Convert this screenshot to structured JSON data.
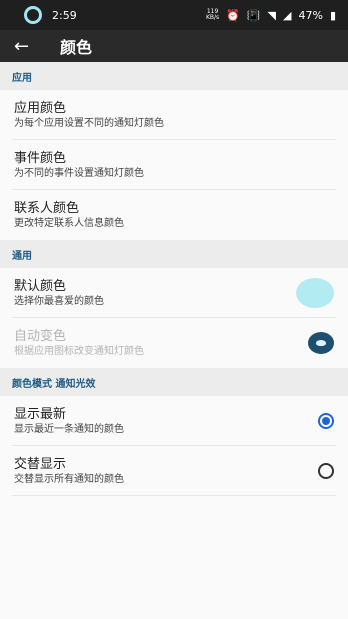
{
  "status": {
    "time": "2:59",
    "net_top": "119",
    "net_bottom": "KB/s",
    "battery": "47%"
  },
  "header": {
    "title": "颜色"
  },
  "sections": [
    {
      "title": "应用"
    },
    {
      "title": "通用"
    },
    {
      "title": "颜色模式 通知光效"
    }
  ],
  "items": [
    {
      "title": "应用颜色",
      "subtitle": "为每个应用设置不同的通知灯颜色"
    },
    {
      "title": "事件颜色",
      "subtitle": "为不同的事件设置通知灯颜色"
    },
    {
      "title": "联系人颜色",
      "subtitle": "更改特定联系人信息颜色"
    },
    {
      "title": "默认颜色",
      "subtitle": "选择你最喜爱的颜色"
    },
    {
      "title": "自动变色",
      "subtitle": "根据应用图标改变通知灯颜色"
    },
    {
      "title": "显示最新",
      "subtitle": "显示最近一条通知的颜色"
    },
    {
      "title": "交替显示",
      "subtitle": "交替显示所有通知的颜色"
    }
  ],
  "colors": {
    "status_bar": "#1f1f1f",
    "app_bar": "#2a2a2a",
    "accent": "#1e66d0",
    "section_text": "#1e5b86",
    "swatch": "#b2ebf2"
  },
  "controls": {
    "default_color_swatch": "swatch-circle",
    "auto_color_state": "on",
    "mode_selected": "显示最新"
  }
}
